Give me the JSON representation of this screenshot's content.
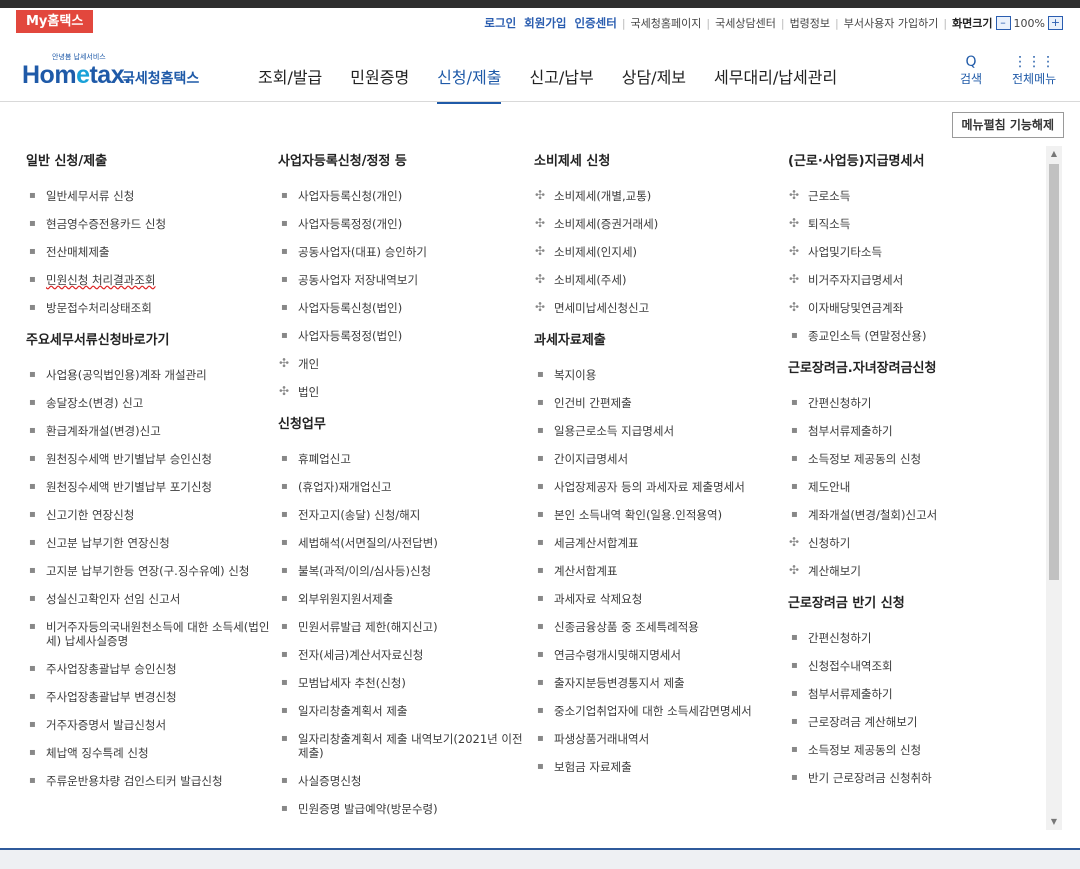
{
  "topbar": {
    "my_hometax": "My홈택스",
    "links_strong": [
      "로그인",
      "회원가입",
      "인증센터"
    ],
    "links_plain": [
      "국세청홈페이지",
      "국세상담센터",
      "법령정보",
      "부서사용자 가입하기"
    ],
    "font_size_label": "화면크기",
    "zoom_minus": "–",
    "zoom_value": "100%",
    "zoom_plus": "+"
  },
  "header": {
    "logo_small": "안녕봄 납세서비스",
    "logo_home": "Hom",
    "logo_e": "e",
    "logo_tax": "tax.",
    "logo_sub": "국세청홈택스",
    "nav": [
      "조회/발급",
      "민원증명",
      "신청/제출",
      "신고/납부",
      "상담/제보",
      "세무대리/납세관리"
    ],
    "search_icon": "Q",
    "search_label": "검색",
    "allmenu_icon": "⋮⋮⋮",
    "allmenu_label": "전체메뉴"
  },
  "collapse_button": "메뉴펼침 기능해제",
  "columns": [
    {
      "sections": [
        {
          "title": "일반 신청/제출",
          "items": [
            {
              "label": "일반세무서류 신청",
              "marker": "dot"
            },
            {
              "label": "현금영수증전용카드 신청",
              "marker": "dot"
            },
            {
              "label": "전산매체제출",
              "marker": "dot"
            },
            {
              "label": "민원신청 처리결과조회",
              "marker": "dot",
              "underline": true
            },
            {
              "label": "방문접수처리상태조회",
              "marker": "dot"
            }
          ]
        },
        {
          "title": "주요세무서류신청바로가기",
          "items": [
            {
              "label": "사업용(공익법인용)계좌 개설관리",
              "marker": "dot"
            },
            {
              "label": "송달장소(변경) 신고",
              "marker": "dot"
            },
            {
              "label": "환급계좌개설(변경)신고",
              "marker": "dot"
            },
            {
              "label": "원천징수세액 반기별납부 승인신청",
              "marker": "dot"
            },
            {
              "label": "원천징수세액 반기별납부 포기신청",
              "marker": "dot"
            },
            {
              "label": "신고기한 연장신청",
              "marker": "dot"
            },
            {
              "label": "신고분 납부기한 연장신청",
              "marker": "dot"
            },
            {
              "label": "고지분 납부기한등 연장(구.징수유예) 신청",
              "marker": "dot"
            },
            {
              "label": "성실신고확인자 선임 신고서",
              "marker": "dot"
            },
            {
              "label": "비거주자등의국내원천소득에 대한 소득세(법인세) 납세사실증명",
              "marker": "dot"
            },
            {
              "label": "주사업장총괄납부 승인신청",
              "marker": "dot"
            },
            {
              "label": "주사업장총괄납부 변경신청",
              "marker": "dot"
            },
            {
              "label": "거주자증명서 발급신청서",
              "marker": "dot"
            },
            {
              "label": "체납액 징수특례 신청",
              "marker": "dot"
            },
            {
              "label": "주류운반용차량 검인스티커 발급신청",
              "marker": "dot"
            }
          ]
        }
      ]
    },
    {
      "sections": [
        {
          "title": "사업자등록신청/정정 등",
          "items": [
            {
              "label": "사업자등록신청(개인)",
              "marker": "dot"
            },
            {
              "label": "사업자등록정정(개인)",
              "marker": "dot"
            },
            {
              "label": "공동사업자(대표) 승인하기",
              "marker": "dot"
            },
            {
              "label": "공동사업자 저장내역보기",
              "marker": "dot"
            },
            {
              "label": "사업자등록신청(법인)",
              "marker": "dot"
            },
            {
              "label": "사업자등록정정(법인)",
              "marker": "dot"
            },
            {
              "label": "개인",
              "marker": "cross"
            },
            {
              "label": "법인",
              "marker": "cross"
            }
          ]
        },
        {
          "title": "신청업무",
          "items": [
            {
              "label": "휴폐업신고",
              "marker": "dot"
            },
            {
              "label": "(휴업자)재개업신고",
              "marker": "dot"
            },
            {
              "label": "전자고지(송달) 신청/해지",
              "marker": "dot"
            },
            {
              "label": "세법해석(서면질의/사전답변)",
              "marker": "dot"
            },
            {
              "label": "불복(과적/이의/심사등)신청",
              "marker": "dot"
            },
            {
              "label": "외부위원지원서제출",
              "marker": "dot"
            },
            {
              "label": "민원서류발급 제한(해지신고)",
              "marker": "dot"
            },
            {
              "label": "전자(세금)계산서자료신청",
              "marker": "dot"
            },
            {
              "label": "모범납세자 추천(신청)",
              "marker": "dot"
            },
            {
              "label": "일자리창출계획서 제출",
              "marker": "dot"
            },
            {
              "label": "일자리창출계획서 제출 내역보기(2021년 이전 제출)",
              "marker": "dot"
            },
            {
              "label": "사실증명신청",
              "marker": "dot"
            },
            {
              "label": "민원증명 발급예약(방문수령)",
              "marker": "dot"
            }
          ]
        }
      ]
    },
    {
      "sections": [
        {
          "title": "소비제세 신청",
          "items": [
            {
              "label": "소비제세(개별,교통)",
              "marker": "cross"
            },
            {
              "label": "소비제세(증권거래세)",
              "marker": "cross"
            },
            {
              "label": "소비제세(인지세)",
              "marker": "cross"
            },
            {
              "label": "소비제세(주세)",
              "marker": "cross"
            },
            {
              "label": "면세미납세신청신고",
              "marker": "cross"
            }
          ]
        },
        {
          "title": "과세자료제출",
          "items": [
            {
              "label": "복지이용",
              "marker": "dot"
            },
            {
              "label": "인건비 간편제출",
              "marker": "dot"
            },
            {
              "label": "일용근로소득 지급명세서",
              "marker": "dot"
            },
            {
              "label": "간이지급명세서",
              "marker": "dot"
            },
            {
              "label": "사업장제공자 등의 과세자료 제출명세서",
              "marker": "dot"
            },
            {
              "label": "본인 소득내역 확인(일용.인적용역)",
              "marker": "dot"
            },
            {
              "label": "세금계산서합계표",
              "marker": "dot"
            },
            {
              "label": "계산서합계표",
              "marker": "dot"
            },
            {
              "label": "과세자료 삭제요청",
              "marker": "dot"
            },
            {
              "label": "신종금융상품 중 조세특례적용",
              "marker": "dot"
            },
            {
              "label": "연금수령개시및해지명세서",
              "marker": "dot"
            },
            {
              "label": "출자지분등변경통지서 제출",
              "marker": "dot"
            },
            {
              "label": "중소기업취업자에 대한 소득세감면명세서",
              "marker": "dot"
            },
            {
              "label": "파생상품거래내역서",
              "marker": "dot"
            },
            {
              "label": "보험금 자료제출",
              "marker": "dot"
            }
          ]
        }
      ]
    },
    {
      "sections": [
        {
          "title": "(근로·사업등)지급명세서",
          "items": [
            {
              "label": "근로소득",
              "marker": "cross"
            },
            {
              "label": "퇴직소득",
              "marker": "cross"
            },
            {
              "label": "사업및기타소득",
              "marker": "cross"
            },
            {
              "label": "비거주자지급명세서",
              "marker": "cross"
            },
            {
              "label": "이자배당및연금계좌",
              "marker": "cross"
            },
            {
              "label": "종교인소득 (연말정산용)",
              "marker": "dot"
            }
          ]
        },
        {
          "title": "근로장려금.자녀장려금신청",
          "items": [
            {
              "label": "간편신청하기",
              "marker": "dot"
            },
            {
              "label": "첨부서류제출하기",
              "marker": "dot"
            },
            {
              "label": "소득정보 제공동의 신청",
              "marker": "dot"
            },
            {
              "label": "제도안내",
              "marker": "dot"
            },
            {
              "label": "계좌개설(변경/철회)신고서",
              "marker": "dot"
            },
            {
              "label": "신청하기",
              "marker": "cross"
            },
            {
              "label": "계산해보기",
              "marker": "cross"
            }
          ]
        },
        {
          "title": "근로장려금 반기 신청",
          "items": [
            {
              "label": "간편신청하기",
              "marker": "dot"
            },
            {
              "label": "신청접수내역조회",
              "marker": "dot"
            },
            {
              "label": "첨부서류제출하기",
              "marker": "dot"
            },
            {
              "label": "근로장려금 계산해보기",
              "marker": "dot"
            },
            {
              "label": "소득정보 제공동의 신청",
              "marker": "dot"
            },
            {
              "label": "반기 근로장려금 신청취하",
              "marker": "dot"
            }
          ]
        }
      ]
    }
  ]
}
